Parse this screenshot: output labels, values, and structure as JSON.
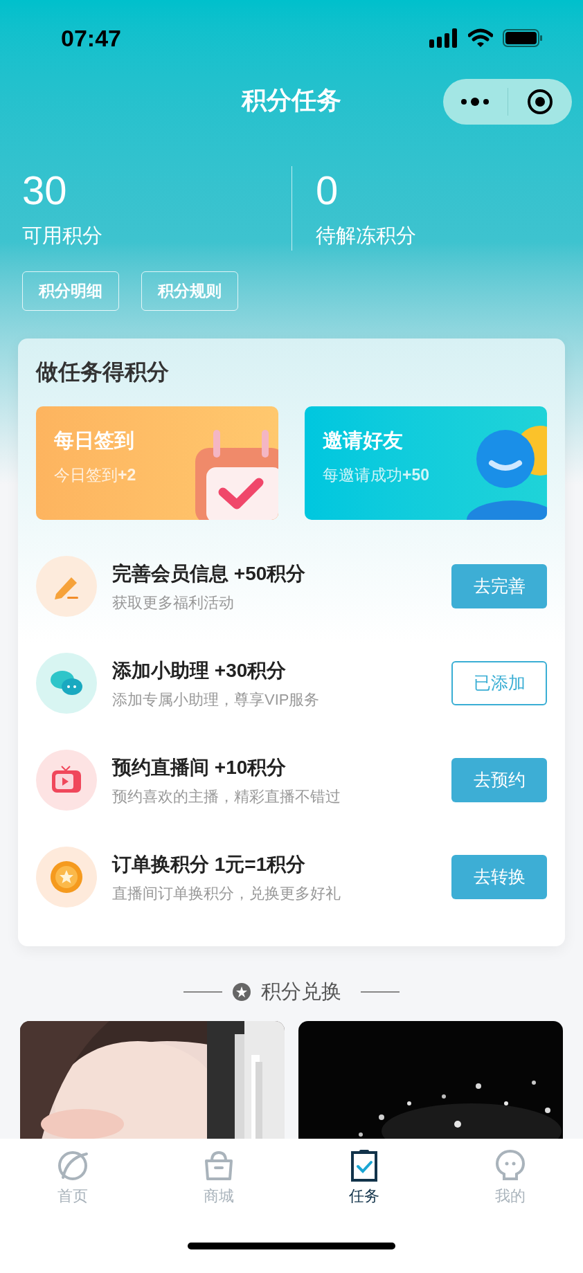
{
  "status_bar": {
    "time": "07:47"
  },
  "header": {
    "title": "积分任务"
  },
  "stats": [
    {
      "value": "30",
      "label": "可用积分"
    },
    {
      "value": "0",
      "label": "待解冻积分"
    }
  ],
  "header_buttons": [
    "积分明细",
    "积分规则"
  ],
  "tasks_card": {
    "title": "做任务得积分",
    "promos": [
      {
        "kind": "checkin",
        "title": "每日签到",
        "subtitle": "今日签到**+2**"
      },
      {
        "kind": "invite",
        "title": "邀请好友",
        "subtitle": "每邀请成功**+50**"
      }
    ],
    "tasks": [
      {
        "kind": "profile",
        "title": "完善会员信息 +50积分",
        "subtitle": "获取更多福利活动",
        "button": "去完善",
        "done": false
      },
      {
        "kind": "chat",
        "title": "添加小助理 +30积分",
        "subtitle": "添加专属小助理，尊享VIP服务",
        "button": "已添加",
        "done": true
      },
      {
        "kind": "live",
        "title": "预约直播间 +10积分",
        "subtitle": "预约喜欢的主播，精彩直播不错过",
        "button": "去预约",
        "done": false
      },
      {
        "kind": "coin",
        "title": "订单换积分 1元=1积分",
        "subtitle": "直播间订单换积分，兑换更多好礼",
        "button": "去转换",
        "done": false
      }
    ]
  },
  "exchange": {
    "title": "积分兑换"
  },
  "tab_bar": [
    {
      "kind": "home",
      "label": "首页",
      "selected": false
    },
    {
      "kind": "shop",
      "label": "商城",
      "selected": false
    },
    {
      "kind": "task",
      "label": "任务",
      "selected": true
    },
    {
      "kind": "me",
      "label": "我的",
      "selected": false
    }
  ]
}
